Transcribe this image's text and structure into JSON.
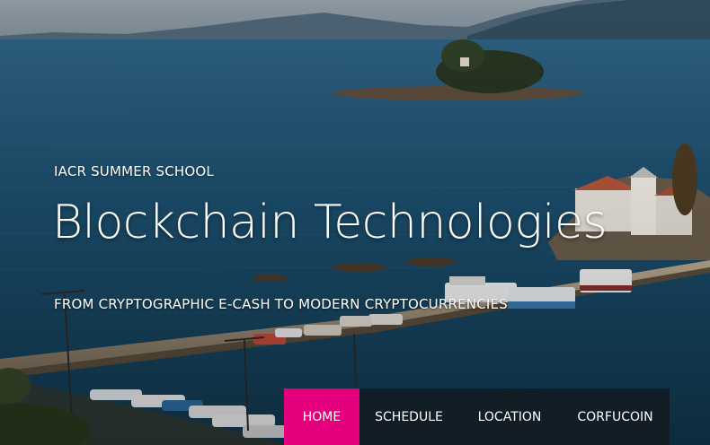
{
  "hero": {
    "eyebrow": "IACR SUMMER SCHOOL",
    "title": "Blockchain Technologies",
    "tagline": "FROM CRYPTOGRAPHIC E-CASH TO MODERN CRYPTOCURRENCIES"
  },
  "nav": {
    "items": [
      {
        "label": "HOME",
        "active": true
      },
      {
        "label": "SCHEDULE",
        "active": false
      },
      {
        "label": "LOCATION",
        "active": false
      },
      {
        "label": "CORFUCOIN",
        "active": false
      }
    ]
  },
  "colors": {
    "accent": "#e4007c",
    "nav_bg": "#14181c",
    "sea": "#1a4b6a"
  }
}
